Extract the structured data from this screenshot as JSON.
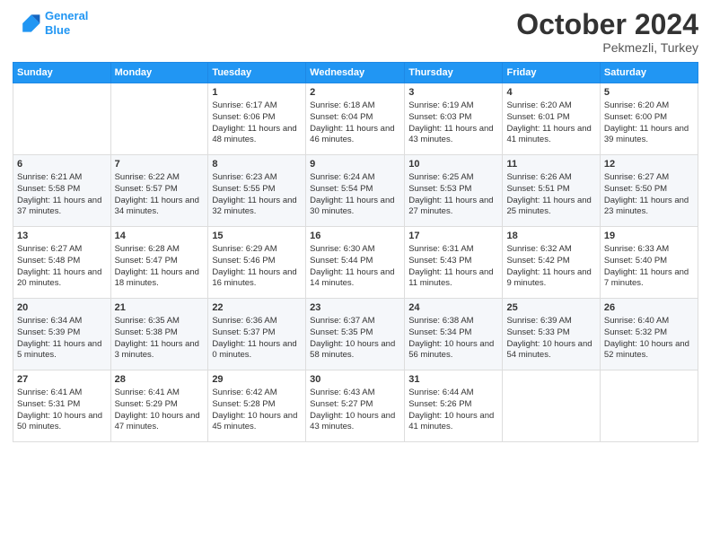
{
  "header": {
    "logo_line1": "General",
    "logo_line2": "Blue",
    "month": "October 2024",
    "location": "Pekmezli, Turkey"
  },
  "days_of_week": [
    "Sunday",
    "Monday",
    "Tuesday",
    "Wednesday",
    "Thursday",
    "Friday",
    "Saturday"
  ],
  "weeks": [
    [
      {
        "day": "",
        "info": ""
      },
      {
        "day": "",
        "info": ""
      },
      {
        "day": "1",
        "info": "Sunrise: 6:17 AM\nSunset: 6:06 PM\nDaylight: 11 hours and 48 minutes."
      },
      {
        "day": "2",
        "info": "Sunrise: 6:18 AM\nSunset: 6:04 PM\nDaylight: 11 hours and 46 minutes."
      },
      {
        "day": "3",
        "info": "Sunrise: 6:19 AM\nSunset: 6:03 PM\nDaylight: 11 hours and 43 minutes."
      },
      {
        "day": "4",
        "info": "Sunrise: 6:20 AM\nSunset: 6:01 PM\nDaylight: 11 hours and 41 minutes."
      },
      {
        "day": "5",
        "info": "Sunrise: 6:20 AM\nSunset: 6:00 PM\nDaylight: 11 hours and 39 minutes."
      }
    ],
    [
      {
        "day": "6",
        "info": "Sunrise: 6:21 AM\nSunset: 5:58 PM\nDaylight: 11 hours and 37 minutes."
      },
      {
        "day": "7",
        "info": "Sunrise: 6:22 AM\nSunset: 5:57 PM\nDaylight: 11 hours and 34 minutes."
      },
      {
        "day": "8",
        "info": "Sunrise: 6:23 AM\nSunset: 5:55 PM\nDaylight: 11 hours and 32 minutes."
      },
      {
        "day": "9",
        "info": "Sunrise: 6:24 AM\nSunset: 5:54 PM\nDaylight: 11 hours and 30 minutes."
      },
      {
        "day": "10",
        "info": "Sunrise: 6:25 AM\nSunset: 5:53 PM\nDaylight: 11 hours and 27 minutes."
      },
      {
        "day": "11",
        "info": "Sunrise: 6:26 AM\nSunset: 5:51 PM\nDaylight: 11 hours and 25 minutes."
      },
      {
        "day": "12",
        "info": "Sunrise: 6:27 AM\nSunset: 5:50 PM\nDaylight: 11 hours and 23 minutes."
      }
    ],
    [
      {
        "day": "13",
        "info": "Sunrise: 6:27 AM\nSunset: 5:48 PM\nDaylight: 11 hours and 20 minutes."
      },
      {
        "day": "14",
        "info": "Sunrise: 6:28 AM\nSunset: 5:47 PM\nDaylight: 11 hours and 18 minutes."
      },
      {
        "day": "15",
        "info": "Sunrise: 6:29 AM\nSunset: 5:46 PM\nDaylight: 11 hours and 16 minutes."
      },
      {
        "day": "16",
        "info": "Sunrise: 6:30 AM\nSunset: 5:44 PM\nDaylight: 11 hours and 14 minutes."
      },
      {
        "day": "17",
        "info": "Sunrise: 6:31 AM\nSunset: 5:43 PM\nDaylight: 11 hours and 11 minutes."
      },
      {
        "day": "18",
        "info": "Sunrise: 6:32 AM\nSunset: 5:42 PM\nDaylight: 11 hours and 9 minutes."
      },
      {
        "day": "19",
        "info": "Sunrise: 6:33 AM\nSunset: 5:40 PM\nDaylight: 11 hours and 7 minutes."
      }
    ],
    [
      {
        "day": "20",
        "info": "Sunrise: 6:34 AM\nSunset: 5:39 PM\nDaylight: 11 hours and 5 minutes."
      },
      {
        "day": "21",
        "info": "Sunrise: 6:35 AM\nSunset: 5:38 PM\nDaylight: 11 hours and 3 minutes."
      },
      {
        "day": "22",
        "info": "Sunrise: 6:36 AM\nSunset: 5:37 PM\nDaylight: 11 hours and 0 minutes."
      },
      {
        "day": "23",
        "info": "Sunrise: 6:37 AM\nSunset: 5:35 PM\nDaylight: 10 hours and 58 minutes."
      },
      {
        "day": "24",
        "info": "Sunrise: 6:38 AM\nSunset: 5:34 PM\nDaylight: 10 hours and 56 minutes."
      },
      {
        "day": "25",
        "info": "Sunrise: 6:39 AM\nSunset: 5:33 PM\nDaylight: 10 hours and 54 minutes."
      },
      {
        "day": "26",
        "info": "Sunrise: 6:40 AM\nSunset: 5:32 PM\nDaylight: 10 hours and 52 minutes."
      }
    ],
    [
      {
        "day": "27",
        "info": "Sunrise: 6:41 AM\nSunset: 5:31 PM\nDaylight: 10 hours and 50 minutes."
      },
      {
        "day": "28",
        "info": "Sunrise: 6:41 AM\nSunset: 5:29 PM\nDaylight: 10 hours and 47 minutes."
      },
      {
        "day": "29",
        "info": "Sunrise: 6:42 AM\nSunset: 5:28 PM\nDaylight: 10 hours and 45 minutes."
      },
      {
        "day": "30",
        "info": "Sunrise: 6:43 AM\nSunset: 5:27 PM\nDaylight: 10 hours and 43 minutes."
      },
      {
        "day": "31",
        "info": "Sunrise: 6:44 AM\nSunset: 5:26 PM\nDaylight: 10 hours and 41 minutes."
      },
      {
        "day": "",
        "info": ""
      },
      {
        "day": "",
        "info": ""
      }
    ]
  ]
}
